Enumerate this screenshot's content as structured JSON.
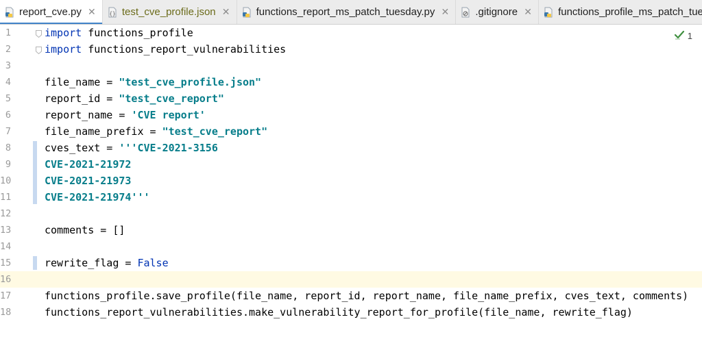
{
  "tabs": [
    {
      "name": "tab-report-cve",
      "label": "report_cve.py",
      "icon": "python-file-icon",
      "active": true,
      "type": "py"
    },
    {
      "name": "tab-test-cve-profile",
      "label": "test_cve_profile.json",
      "icon": "json-file-icon",
      "active": false,
      "type": "json"
    },
    {
      "name": "tab-functions-report-ms",
      "label": "functions_report_ms_patch_tuesday.py",
      "icon": "python-file-icon",
      "active": false,
      "type": "py"
    },
    {
      "name": "tab-gitignore",
      "label": ".gitignore",
      "icon": "ignore-file-icon",
      "active": false,
      "type": "ignore"
    },
    {
      "name": "tab-functions-profile-ms",
      "label": "functions_profile_ms_patch_tuesday.py",
      "icon": "python-file-icon",
      "active": false,
      "type": "py"
    }
  ],
  "inspection": {
    "icon": "check-mark-icon",
    "count": "1"
  },
  "editor": {
    "current_line": 16,
    "lines": [
      {
        "n": "1",
        "tokens": [
          [
            "kw",
            "import"
          ],
          [
            "",
            "functions_profile"
          ]
        ],
        "spaced": true
      },
      {
        "n": "2",
        "tokens": [
          [
            "kw",
            "import"
          ],
          [
            "",
            "functions_report_vulnerabilities"
          ]
        ],
        "spaced": true
      },
      {
        "n": "3",
        "tokens": []
      },
      {
        "n": "4",
        "tokens": [
          [
            "",
            "file_name = "
          ],
          [
            "str2",
            "\"test_cve_profile.json\""
          ]
        ]
      },
      {
        "n": "5",
        "tokens": [
          [
            "",
            "report_id = "
          ],
          [
            "str2",
            "\"test_cve_report\""
          ]
        ]
      },
      {
        "n": "6",
        "tokens": [
          [
            "",
            "report_name = "
          ],
          [
            "str2",
            "'CVE report'"
          ]
        ]
      },
      {
        "n": "7",
        "tokens": [
          [
            "",
            "file_name_prefix = "
          ],
          [
            "str2",
            "\"test_cve_report\""
          ]
        ]
      },
      {
        "n": "8",
        "tokens": [
          [
            "",
            "cves_text = "
          ],
          [
            "str2",
            "'''CVE-2021-3156"
          ]
        ]
      },
      {
        "n": "9",
        "tokens": [
          [
            "str2",
            "CVE-2021-21972"
          ]
        ]
      },
      {
        "n": "10",
        "tokens": [
          [
            "str2",
            "CVE-2021-21973"
          ]
        ]
      },
      {
        "n": "11",
        "tokens": [
          [
            "str2",
            "CVE-2021-21974'''"
          ]
        ]
      },
      {
        "n": "12",
        "tokens": []
      },
      {
        "n": "13",
        "tokens": [
          [
            "",
            "comments = []"
          ]
        ]
      },
      {
        "n": "14",
        "tokens": []
      },
      {
        "n": "15",
        "tokens": [
          [
            "",
            "rewrite_flag = "
          ],
          [
            "kw",
            "False"
          ]
        ]
      },
      {
        "n": "16",
        "tokens": []
      },
      {
        "n": "17",
        "tokens": [
          [
            "",
            "functions_profile.save_profile(file_name, report_id, report_name, file_name_prefix, cves_text, comments)"
          ]
        ]
      },
      {
        "n": "18",
        "tokens": [
          [
            "",
            "functions_report_vulnerabilities.make_vulnerability_report_for_profile(file_name, rewrite_flag)"
          ]
        ]
      }
    ]
  },
  "colors": {
    "keyword": "#0033b3",
    "string": "#067d8a",
    "accent": "#4083c9",
    "current_line": "#fffae3"
  }
}
